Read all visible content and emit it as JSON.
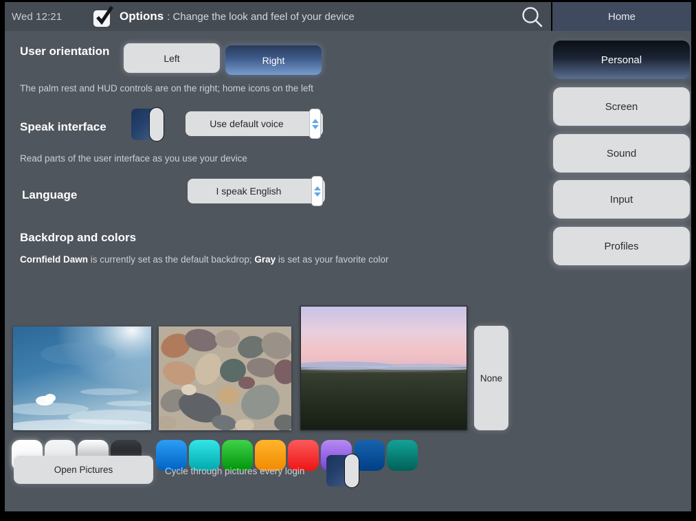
{
  "header": {
    "clock": "Wed 12:21",
    "check_icon": "checkmark-icon",
    "title": "Options",
    "subtitle": ": Change the look and feel of your device",
    "search_icon": "search-icon",
    "home_label": "Home"
  },
  "sidebar": {
    "items": [
      {
        "label": "Personal",
        "selected": true
      },
      {
        "label": "Screen",
        "selected": false
      },
      {
        "label": "Sound",
        "selected": false
      },
      {
        "label": "Input",
        "selected": false
      },
      {
        "label": "Profiles",
        "selected": false
      }
    ]
  },
  "orientation": {
    "label": "User orientation",
    "options": [
      {
        "label": "Left",
        "selected": false
      },
      {
        "label": "Right",
        "selected": true
      }
    ],
    "hint": "The palm rest and HUD controls are on the right; home icons on the left"
  },
  "speak": {
    "label": "Speak interface",
    "toggle_state": "on",
    "voice_value": "Use default voice",
    "hint": "Read parts of the user interface as you use your device"
  },
  "language": {
    "label": "Language",
    "value": "I speak English"
  },
  "backdrop": {
    "heading": "Backdrop and colors",
    "status_prefix": "",
    "status_bold_1": "Cornfield Dawn",
    "status_mid": " is currently set as the default backdrop; ",
    "status_bold_2": "Gray",
    "status_suffix": " is set as your favorite color",
    "wallpapers": [
      {
        "name": "Blue Sky",
        "selected": false
      },
      {
        "name": "Pebbles",
        "selected": false
      },
      {
        "name": "Cornfield Dawn",
        "selected": true
      }
    ],
    "none_label": "None",
    "neutral_colors": [
      "#fbfbfc",
      "#e7e9eb",
      "#9ea3a8",
      "#1f2124"
    ],
    "accent_colors": [
      "#0a84e0",
      "#0fcfd4",
      "#13b81f",
      "#fb9b05",
      "#f42c2c",
      "#9a63ea",
      "#0b4f9e",
      "#07897e"
    ],
    "open_pictures_label": "Open Pictures",
    "cycle_label": "Cycle through pictures every login",
    "cycle_toggle_state": "on"
  }
}
